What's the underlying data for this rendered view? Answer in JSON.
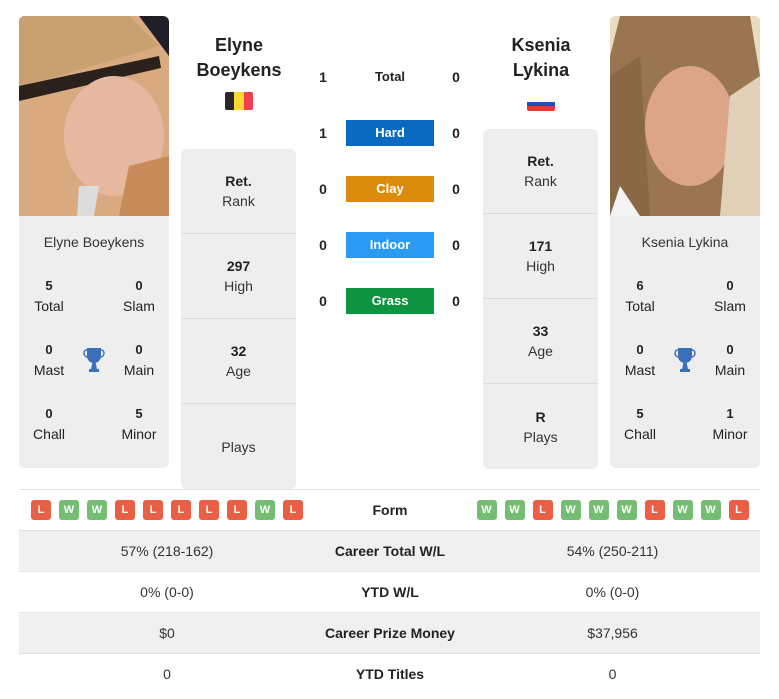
{
  "player1": {
    "name_line1": "Elyne",
    "name_line2": "Boeykens",
    "full_name": "Elyne Boeykens",
    "country": "Belgium",
    "flag_colors": [
      "#2a2a2a",
      "#fdd835",
      "#ef4050"
    ],
    "titles": {
      "total": {
        "value": "5",
        "label": "Total"
      },
      "slam": {
        "value": "0",
        "label": "Slam"
      },
      "mast": {
        "value": "0",
        "label": "Mast"
      },
      "main": {
        "value": "0",
        "label": "Main"
      },
      "chall": {
        "value": "0",
        "label": "Chall"
      },
      "minor": {
        "value": "5",
        "label": "Minor"
      }
    },
    "info": [
      {
        "value": "Ret.",
        "label": "Rank"
      },
      {
        "value": "297",
        "label": "High"
      },
      {
        "value": "32",
        "label": "Age"
      },
      {
        "value": "",
        "label": "Plays"
      }
    ],
    "form": [
      "L",
      "W",
      "W",
      "L",
      "L",
      "L",
      "L",
      "L",
      "W",
      "L"
    ]
  },
  "player2": {
    "name_line1": "Ksenia",
    "name_line2": "Lykina",
    "full_name": "Ksenia Lykina",
    "country": "Russia",
    "flag_colors": [
      "#ffffff",
      "#1d4fc4",
      "#e53935"
    ],
    "titles": {
      "total": {
        "value": "6",
        "label": "Total"
      },
      "slam": {
        "value": "0",
        "label": "Slam"
      },
      "mast": {
        "value": "0",
        "label": "Mast"
      },
      "main": {
        "value": "0",
        "label": "Main"
      },
      "chall": {
        "value": "5",
        "label": "Chall"
      },
      "minor": {
        "value": "1",
        "label": "Minor"
      }
    },
    "info": [
      {
        "value": "Ret.",
        "label": "Rank"
      },
      {
        "value": "171",
        "label": "High"
      },
      {
        "value": "33",
        "label": "Age"
      },
      {
        "value": "R",
        "label": "Plays"
      }
    ],
    "form": [
      "W",
      "W",
      "L",
      "W",
      "W",
      "W",
      "L",
      "W",
      "W",
      "L"
    ]
  },
  "h2h": [
    {
      "label": "Total",
      "p1": "1",
      "p2": "0",
      "color": ""
    },
    {
      "label": "Hard",
      "p1": "1",
      "p2": "0",
      "color": "#0a6abf"
    },
    {
      "label": "Clay",
      "p1": "0",
      "p2": "0",
      "color": "#dc8c0c"
    },
    {
      "label": "Indoor",
      "p1": "0",
      "p2": "0",
      "color": "#2b9af3"
    },
    {
      "label": "Grass",
      "p1": "0",
      "p2": "0",
      "color": "#0e9340"
    }
  ],
  "comparison": [
    {
      "label": "Form"
    },
    {
      "label": "Career Total W/L",
      "p1": "57% (218-162)",
      "p2": "54% (250-211)"
    },
    {
      "label": "YTD W/L",
      "p1": "0% (0-0)",
      "p2": "0% (0-0)"
    },
    {
      "label": "Career Prize Money",
      "p1": "$0",
      "p2": "$37,956"
    },
    {
      "label": "YTD Titles",
      "p1": "0",
      "p2": "0"
    }
  ]
}
